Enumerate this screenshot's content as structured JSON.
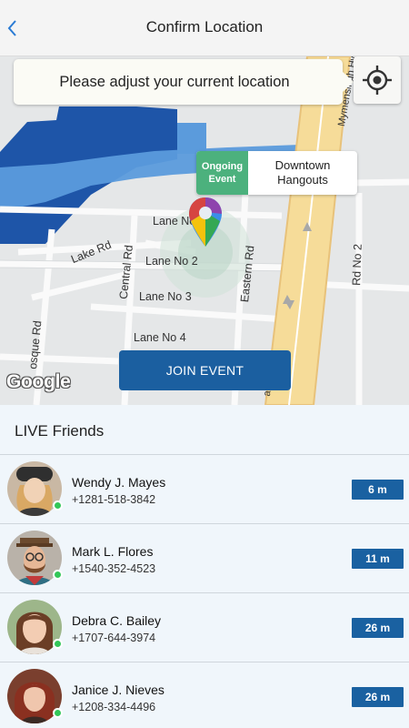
{
  "header": {
    "title": "Confirm Location",
    "back_icon": "chevron-left-icon"
  },
  "map": {
    "banner_text": "Please adjust your current location",
    "locate_icon": "crosshair-icon",
    "event": {
      "tag": "Ongoing Event",
      "name": "Downtown Hangouts"
    },
    "roads": {
      "lane_no_2_top": "Lane No 2",
      "lane_no_2": "Lane No 2",
      "lane_no_3": "Lane No 3",
      "lane_no_4": "Lane No 4",
      "lake_rd": "Lake Rd",
      "central_rd": "Central Rd",
      "eastern_rd": "Eastern Rd",
      "rd_no_2": "Rd No 2",
      "mosque_rd": "osque Rd",
      "mymensingh_hwy": "Mymensingh Hwy",
      "highway_fragment": "ali"
    },
    "join_button": "JOIN EVENT",
    "provider": "Google",
    "pin_icon": "location-pin-icon"
  },
  "friends": {
    "title": "LIVE Friends",
    "items": [
      {
        "name": "Wendy J. Mayes",
        "phone": "+1281-518-3842",
        "distance": "6 m",
        "online": true
      },
      {
        "name": "Mark L. Flores",
        "phone": "+1540-352-4523",
        "distance": "11 m",
        "online": true
      },
      {
        "name": "Debra C. Bailey",
        "phone": "+1707-644-3974",
        "distance": "26 m",
        "online": true
      },
      {
        "name": "Janice J. Nieves",
        "phone": "+1208-334-4496",
        "distance": "26 m",
        "online": true
      }
    ]
  },
  "colors": {
    "primary": "#1b5fa0",
    "event_green": "#4cb17d",
    "online_green": "#34c759",
    "water_blue": "#4a8fd0",
    "building_blue": "#1e55a8",
    "highway_yellow": "#f6dc99"
  }
}
